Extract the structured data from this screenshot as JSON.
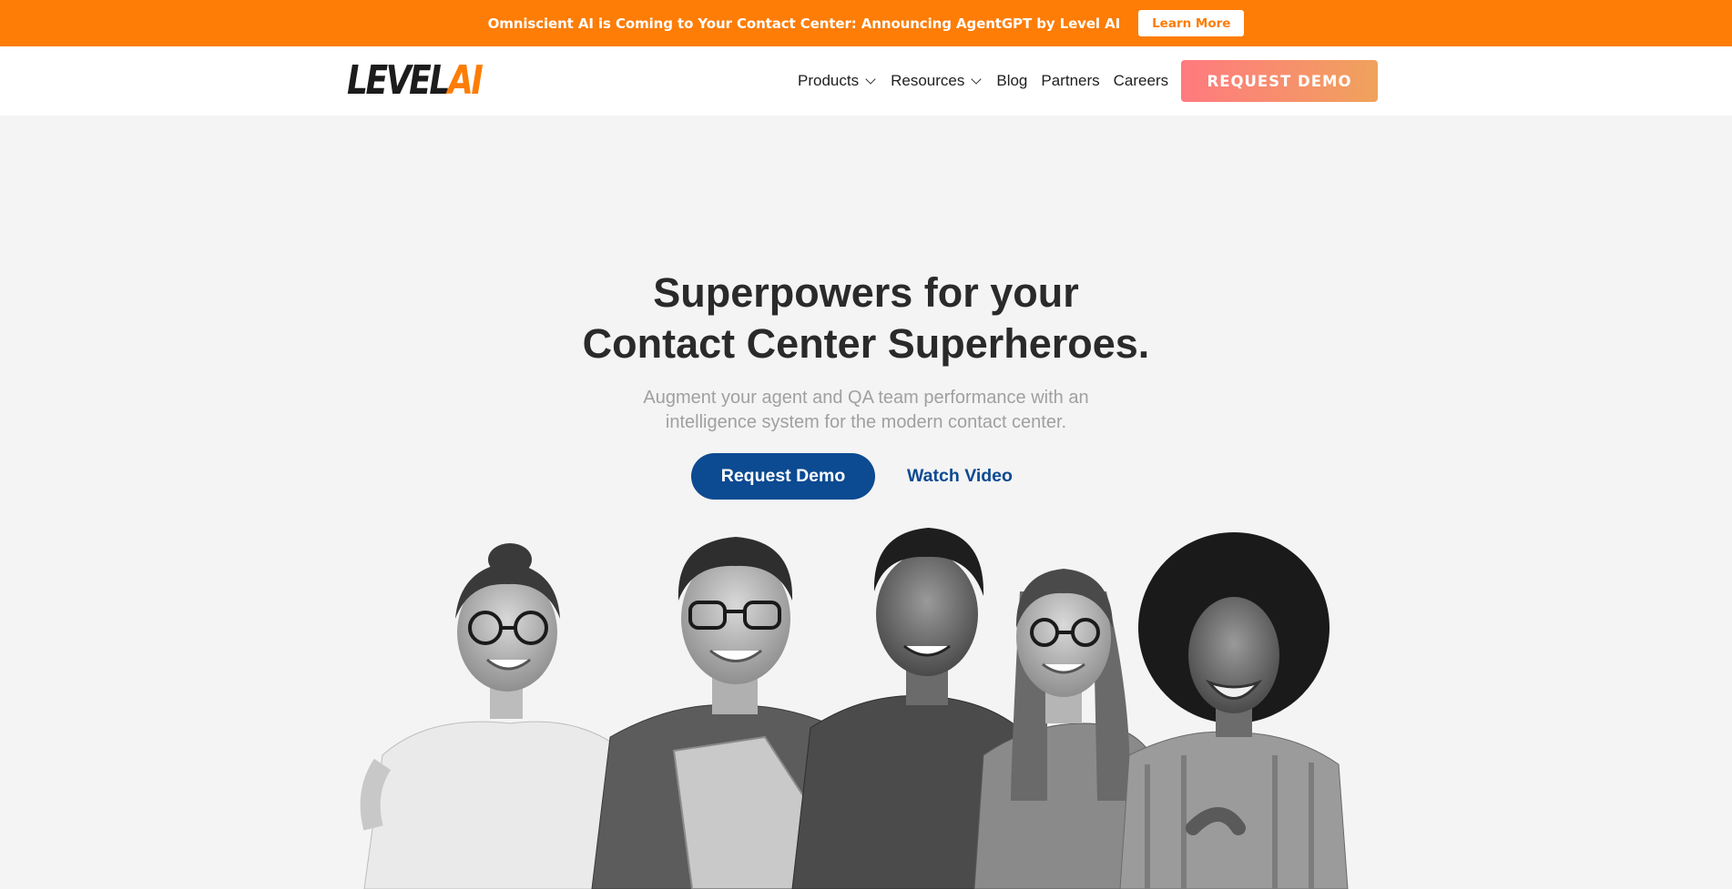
{
  "announcement": {
    "text": "Omniscient AI is Coming to Your Contact Center: Announcing AgentGPT by Level AI",
    "button_label": "Learn More"
  },
  "brand": {
    "logo_level": "LEVEL",
    "logo_ai": "AI",
    "accent_color": "#fd7d06",
    "primary_color": "#0c4a91"
  },
  "nav": {
    "items": [
      {
        "label": "Products",
        "icon": "chevron-down-icon"
      },
      {
        "label": "Resources",
        "icon": "chevron-down-icon"
      },
      {
        "label": "Blog"
      },
      {
        "label": "Partners"
      },
      {
        "label": "Careers"
      }
    ],
    "cta_label": "REQUEST DEMO"
  },
  "hero": {
    "title_line1": "Superpowers for your",
    "title_line2": "Contact Center Superheroes.",
    "subtitle_line1": "Augment your agent and QA team performance with an",
    "subtitle_line2": "intelligence system for the modern contact center.",
    "primary_button": "Request Demo",
    "secondary_button": "Watch Video",
    "image_description": "team-photo"
  }
}
